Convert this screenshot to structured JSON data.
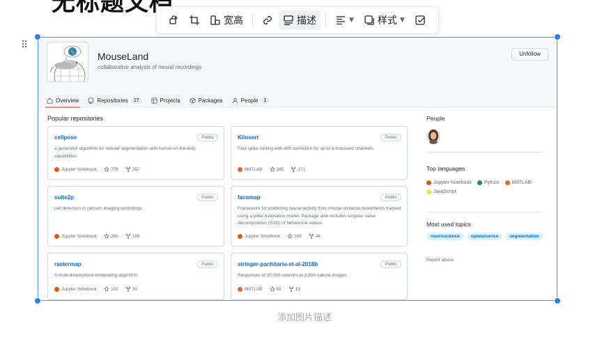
{
  "document": {
    "title": "无标题文档"
  },
  "toolbar": {
    "items": [
      {
        "icon": "rotate-icon",
        "label": ""
      },
      {
        "icon": "crop-icon",
        "label": ""
      },
      {
        "icon": "image-width-icon",
        "label": "宽高"
      },
      {
        "icon": "link-icon",
        "label": ""
      },
      {
        "icon": "caption-icon",
        "label": "描述"
      },
      {
        "icon": "align-icon",
        "label": ""
      },
      {
        "icon": "style-icon",
        "label": "样式"
      },
      {
        "icon": "check-icon",
        "label": ""
      }
    ]
  },
  "caption": {
    "placeholder": "添加图片描述"
  },
  "github": {
    "org_name": "MouseLand",
    "org_desc": "collaborative analysis of neural recordings",
    "follow_button": "Unfollow",
    "tabs": [
      {
        "label": "Overview",
        "count": ""
      },
      {
        "label": "Repositories",
        "count": "17"
      },
      {
        "label": "Projects",
        "count": ""
      },
      {
        "label": "Packages",
        "count": ""
      },
      {
        "label": "People",
        "count": "1"
      }
    ],
    "popular_title": "Popular repositories",
    "repos": [
      {
        "name": "cellpose",
        "visibility": "Public",
        "desc": "a generalist algorithm for cellular segmentation with human-in-the-loop capabilities",
        "language": "Jupyter Notebook",
        "lang_color": "#DA5B0B",
        "stars": "778",
        "forks": "257"
      },
      {
        "name": "Kilosort",
        "visibility": "Public",
        "desc": "Fast spike sorting with drift correction for up to a thousand channels",
        "language": "MATLAB",
        "lang_color": "#e16737",
        "stars": "285",
        "forks": "171"
      },
      {
        "name": "suite2p",
        "visibility": "Public",
        "desc": "cell detection in calcium imaging recordings",
        "language": "Jupyter Notebook",
        "lang_color": "#DA5B0B",
        "stars": "266",
        "forks": "195"
      },
      {
        "name": "facemap",
        "visibility": "Public",
        "desc": "Framework for predicting neural activity from mouse orofacial movements tracked using a pose estimation model. Package also includes singular value decomposition (SVD) of behavioral videos.",
        "language": "Jupyter Notebook",
        "lang_color": "#DA5B0B",
        "stars": "109",
        "forks": "44"
      },
      {
        "name": "rastermap",
        "visibility": "Public",
        "desc": "A multi-dimensional embedding algorithm",
        "language": "Jupyter Notebook",
        "lang_color": "#DA5B0B",
        "stars": "102",
        "forks": "30"
      },
      {
        "name": "stringer-pachitariu-et-al-2018b",
        "visibility": "Public",
        "desc": "Responses of 10,000 neurons to 2,800 natural images",
        "language": "MATLAB",
        "lang_color": "#e16737",
        "stars": "55",
        "forks": "19"
      }
    ],
    "people_title": "People",
    "top_languages_title": "Top languages",
    "top_languages": [
      {
        "name": "Jupyter Notebook",
        "color": "#DA5B0B"
      },
      {
        "name": "Python",
        "color": "#3572A5"
      },
      {
        "name": "MATLAB",
        "color": "#e16737"
      },
      {
        "name": "JavaScript",
        "color": "#f1e05a"
      }
    ],
    "topics_title": "Most used topics",
    "topics": [
      "neuroscience",
      "opensicence",
      "segmentation"
    ],
    "report": "Report abuse"
  }
}
